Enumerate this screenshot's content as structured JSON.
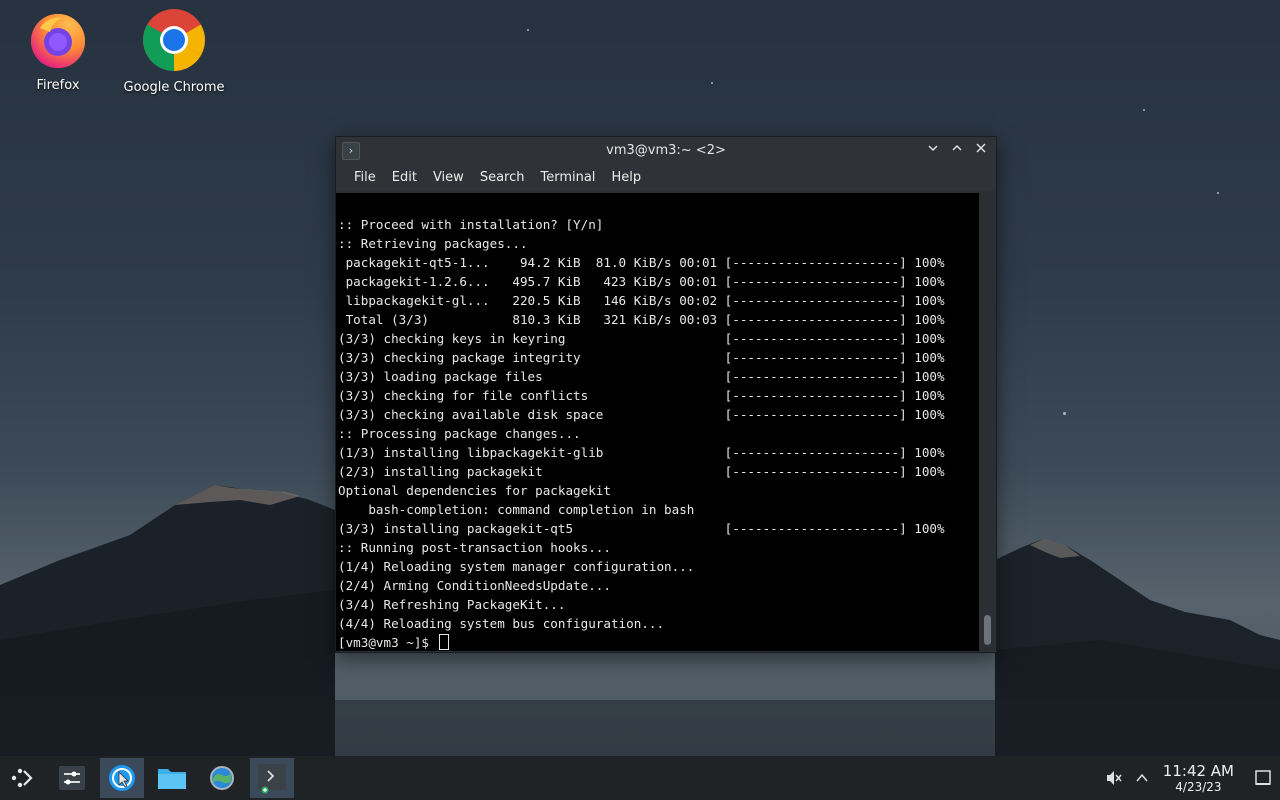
{
  "desktop": {
    "icons": [
      {
        "label": "Firefox"
      },
      {
        "label": "Google Chrome"
      }
    ]
  },
  "terminal": {
    "title": "vm3@vm3:~ <2>",
    "menu": [
      "File",
      "Edit",
      "View",
      "Search",
      "Terminal",
      "Help"
    ],
    "lines": [
      ":: Proceed with installation? [Y/n]",
      ":: Retrieving packages...",
      " packagekit-qt5-1...    94.2 KiB  81.0 KiB/s 00:01 [----------------------] 100%",
      " packagekit-1.2.6...   495.7 KiB   423 KiB/s 00:01 [----------------------] 100%",
      " libpackagekit-gl...   220.5 KiB   146 KiB/s 00:02 [----------------------] 100%",
      " Total (3/3)           810.3 KiB   321 KiB/s 00:03 [----------------------] 100%",
      "(3/3) checking keys in keyring                     [----------------------] 100%",
      "(3/3) checking package integrity                   [----------------------] 100%",
      "(3/3) loading package files                        [----------------------] 100%",
      "(3/3) checking for file conflicts                  [----------------------] 100%",
      "(3/3) checking available disk space                [----------------------] 100%",
      ":: Processing package changes...",
      "(1/3) installing libpackagekit-glib                [----------------------] 100%",
      "(2/3) installing packagekit                        [----------------------] 100%",
      "Optional dependencies for packagekit",
      "    bash-completion: command completion in bash",
      "(3/3) installing packagekit-qt5                    [----------------------] 100%",
      ":: Running post-transaction hooks...",
      "(1/4) Reloading system manager configuration...",
      "(2/4) Arming ConditionNeedsUpdate...",
      "(3/4) Refreshing PackageKit...",
      "(4/4) Reloading system bus configuration..."
    ],
    "prompt": "[vm3@vm3 ~]$ "
  },
  "taskbar": {
    "clock_time": "11:42 AM",
    "clock_date": "4/23/23",
    "icons": [
      "app-launcher-icon",
      "settings-sliders-icon",
      "discover-icon",
      "folder-icon",
      "system-settings-icon",
      "terminal-icon"
    ]
  }
}
